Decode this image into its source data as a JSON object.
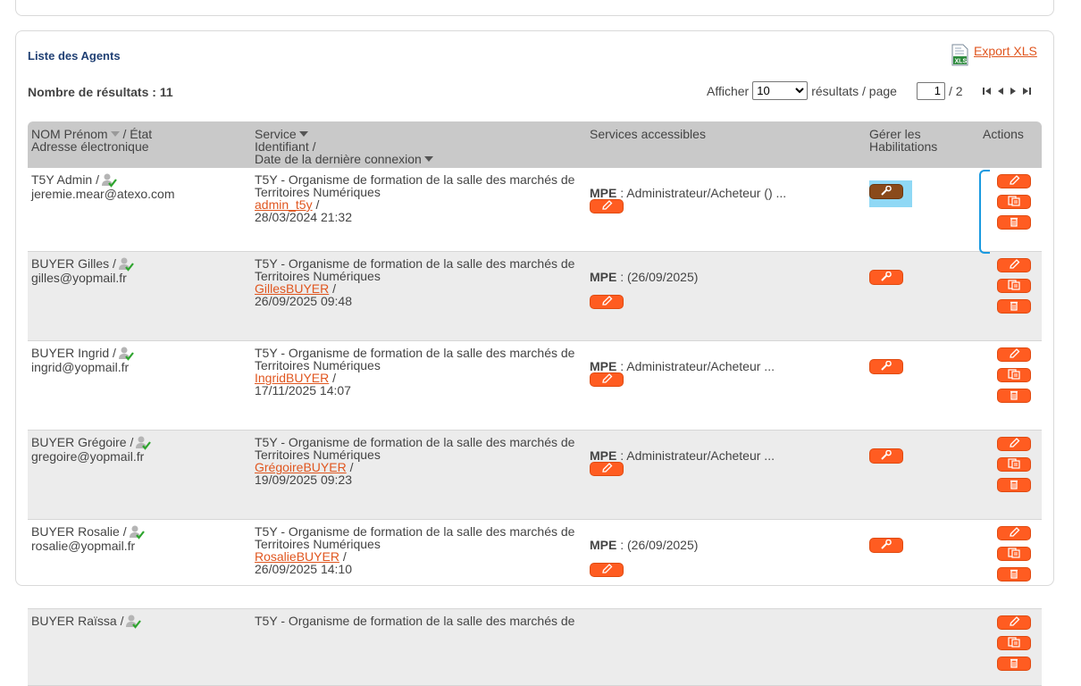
{
  "panel_title": "Liste des Agents",
  "export_label": "Export XLS",
  "results_label": "Nombre de résultats : 11",
  "pager": {
    "show_label": "Afficher",
    "page_size": "10",
    "page_size_options": [
      "10"
    ],
    "per_page_label": "résultats / page",
    "current_page": "1",
    "total_pages": "/ 2"
  },
  "headers": {
    "name_line1": "NOM Prénom",
    "name_state": "/ État",
    "name_line2": "Adresse électronique",
    "service_line1": "Service",
    "service_line2": "Identifiant /",
    "service_line3": "Date de la dernière connexion",
    "accessible": "Services accessibles",
    "habil_line1": "Gérer les",
    "habil_line2": "Habilitations",
    "actions": "Actions"
  },
  "rows": [
    {
      "name": "T5Y Admin /",
      "email": "jeremie.mear@atexo.com",
      "service1": "T5Y - Organisme de formation de la salle des marchés de",
      "service2": "Territoires Numériques",
      "login": "admin_t5y",
      "date": "28/03/2024 21:32",
      "mpe_label": "MPE",
      "mpe_value": " : Administrateur/Acheteur ()  ..."
    },
    {
      "name": "BUYER Gilles /",
      "email": "gilles@yopmail.fr",
      "service1": "T5Y - Organisme de formation de la salle des marchés de",
      "service2": "Territoires Numériques",
      "login": "GillesBUYER",
      "date": "26/09/2025 09:48",
      "mpe_label": "MPE",
      "mpe_value": " : (26/09/2025)"
    },
    {
      "name": "BUYER Ingrid /",
      "email": "ingrid@yopmail.fr",
      "service1": "T5Y - Organisme de formation de la salle des marchés de",
      "service2": "Territoires Numériques",
      "login": "IngridBUYER",
      "date": "17/11/2025 14:07",
      "mpe_label": "MPE",
      "mpe_value": " : Administrateur/Acheteur  ..."
    },
    {
      "name": "BUYER Grégoire /",
      "email": "gregoire@yopmail.fr",
      "service1": "T5Y - Organisme de formation de la salle des marchés de",
      "service2": "Territoires Numériques",
      "login": "GrégoireBUYER",
      "date": "19/09/2025 09:23",
      "mpe_label": "MPE",
      "mpe_value": " : Administrateur/Acheteur  ..."
    },
    {
      "name": "BUYER Rosalie /",
      "email": "rosalie@yopmail.fr",
      "service1": "T5Y - Organisme de formation de la salle des marchés de",
      "service2": "Territoires Numériques",
      "login": "RosalieBUYER",
      "date": "26/09/2025 14:10",
      "mpe_label": "MPE",
      "mpe_value": " : (26/09/2025)"
    },
    {
      "name": "BUYER Raïssa /",
      "service1": "T5Y - Organisme de formation de la salle des marchés de"
    }
  ],
  "colors": {
    "accent": "#ff5c21",
    "header_bg": "#c9c9c9",
    "title": "#1f3f73",
    "link": "#e0561f",
    "highlight": "#8fd8f5"
  }
}
